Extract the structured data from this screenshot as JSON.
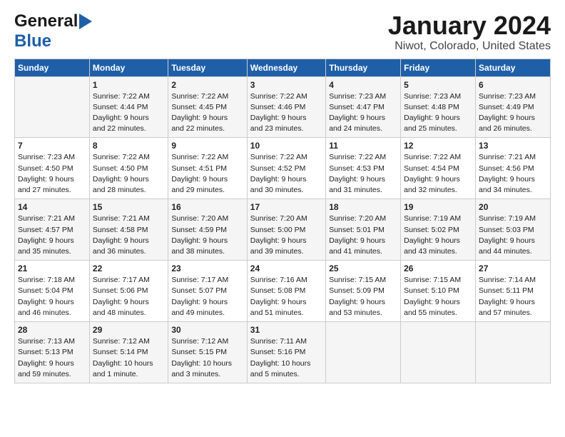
{
  "header": {
    "logo_line1": "General",
    "logo_line2": "Blue",
    "title": "January 2024",
    "subtitle": "Niwot, Colorado, United States"
  },
  "days_of_week": [
    "Sunday",
    "Monday",
    "Tuesday",
    "Wednesday",
    "Thursday",
    "Friday",
    "Saturday"
  ],
  "weeks": [
    [
      {
        "day": "",
        "content": ""
      },
      {
        "day": "1",
        "content": "Sunrise: 7:22 AM\nSunset: 4:44 PM\nDaylight: 9 hours\nand 22 minutes."
      },
      {
        "day": "2",
        "content": "Sunrise: 7:22 AM\nSunset: 4:45 PM\nDaylight: 9 hours\nand 22 minutes."
      },
      {
        "day": "3",
        "content": "Sunrise: 7:22 AM\nSunset: 4:46 PM\nDaylight: 9 hours\nand 23 minutes."
      },
      {
        "day": "4",
        "content": "Sunrise: 7:23 AM\nSunset: 4:47 PM\nDaylight: 9 hours\nand 24 minutes."
      },
      {
        "day": "5",
        "content": "Sunrise: 7:23 AM\nSunset: 4:48 PM\nDaylight: 9 hours\nand 25 minutes."
      },
      {
        "day": "6",
        "content": "Sunrise: 7:23 AM\nSunset: 4:49 PM\nDaylight: 9 hours\nand 26 minutes."
      }
    ],
    [
      {
        "day": "7",
        "content": "Sunrise: 7:23 AM\nSunset: 4:50 PM\nDaylight: 9 hours\nand 27 minutes."
      },
      {
        "day": "8",
        "content": "Sunrise: 7:22 AM\nSunset: 4:50 PM\nDaylight: 9 hours\nand 28 minutes."
      },
      {
        "day": "9",
        "content": "Sunrise: 7:22 AM\nSunset: 4:51 PM\nDaylight: 9 hours\nand 29 minutes."
      },
      {
        "day": "10",
        "content": "Sunrise: 7:22 AM\nSunset: 4:52 PM\nDaylight: 9 hours\nand 30 minutes."
      },
      {
        "day": "11",
        "content": "Sunrise: 7:22 AM\nSunset: 4:53 PM\nDaylight: 9 hours\nand 31 minutes."
      },
      {
        "day": "12",
        "content": "Sunrise: 7:22 AM\nSunset: 4:54 PM\nDaylight: 9 hours\nand 32 minutes."
      },
      {
        "day": "13",
        "content": "Sunrise: 7:21 AM\nSunset: 4:56 PM\nDaylight: 9 hours\nand 34 minutes."
      }
    ],
    [
      {
        "day": "14",
        "content": "Sunrise: 7:21 AM\nSunset: 4:57 PM\nDaylight: 9 hours\nand 35 minutes."
      },
      {
        "day": "15",
        "content": "Sunrise: 7:21 AM\nSunset: 4:58 PM\nDaylight: 9 hours\nand 36 minutes."
      },
      {
        "day": "16",
        "content": "Sunrise: 7:20 AM\nSunset: 4:59 PM\nDaylight: 9 hours\nand 38 minutes."
      },
      {
        "day": "17",
        "content": "Sunrise: 7:20 AM\nSunset: 5:00 PM\nDaylight: 9 hours\nand 39 minutes."
      },
      {
        "day": "18",
        "content": "Sunrise: 7:20 AM\nSunset: 5:01 PM\nDaylight: 9 hours\nand 41 minutes."
      },
      {
        "day": "19",
        "content": "Sunrise: 7:19 AM\nSunset: 5:02 PM\nDaylight: 9 hours\nand 43 minutes."
      },
      {
        "day": "20",
        "content": "Sunrise: 7:19 AM\nSunset: 5:03 PM\nDaylight: 9 hours\nand 44 minutes."
      }
    ],
    [
      {
        "day": "21",
        "content": "Sunrise: 7:18 AM\nSunset: 5:04 PM\nDaylight: 9 hours\nand 46 minutes."
      },
      {
        "day": "22",
        "content": "Sunrise: 7:17 AM\nSunset: 5:06 PM\nDaylight: 9 hours\nand 48 minutes."
      },
      {
        "day": "23",
        "content": "Sunrise: 7:17 AM\nSunset: 5:07 PM\nDaylight: 9 hours\nand 49 minutes."
      },
      {
        "day": "24",
        "content": "Sunrise: 7:16 AM\nSunset: 5:08 PM\nDaylight: 9 hours\nand 51 minutes."
      },
      {
        "day": "25",
        "content": "Sunrise: 7:15 AM\nSunset: 5:09 PM\nDaylight: 9 hours\nand 53 minutes."
      },
      {
        "day": "26",
        "content": "Sunrise: 7:15 AM\nSunset: 5:10 PM\nDaylight: 9 hours\nand 55 minutes."
      },
      {
        "day": "27",
        "content": "Sunrise: 7:14 AM\nSunset: 5:11 PM\nDaylight: 9 hours\nand 57 minutes."
      }
    ],
    [
      {
        "day": "28",
        "content": "Sunrise: 7:13 AM\nSunset: 5:13 PM\nDaylight: 9 hours\nand 59 minutes."
      },
      {
        "day": "29",
        "content": "Sunrise: 7:12 AM\nSunset: 5:14 PM\nDaylight: 10 hours\nand 1 minute."
      },
      {
        "day": "30",
        "content": "Sunrise: 7:12 AM\nSunset: 5:15 PM\nDaylight: 10 hours\nand 3 minutes."
      },
      {
        "day": "31",
        "content": "Sunrise: 7:11 AM\nSunset: 5:16 PM\nDaylight: 10 hours\nand 5 minutes."
      },
      {
        "day": "",
        "content": ""
      },
      {
        "day": "",
        "content": ""
      },
      {
        "day": "",
        "content": ""
      }
    ]
  ]
}
